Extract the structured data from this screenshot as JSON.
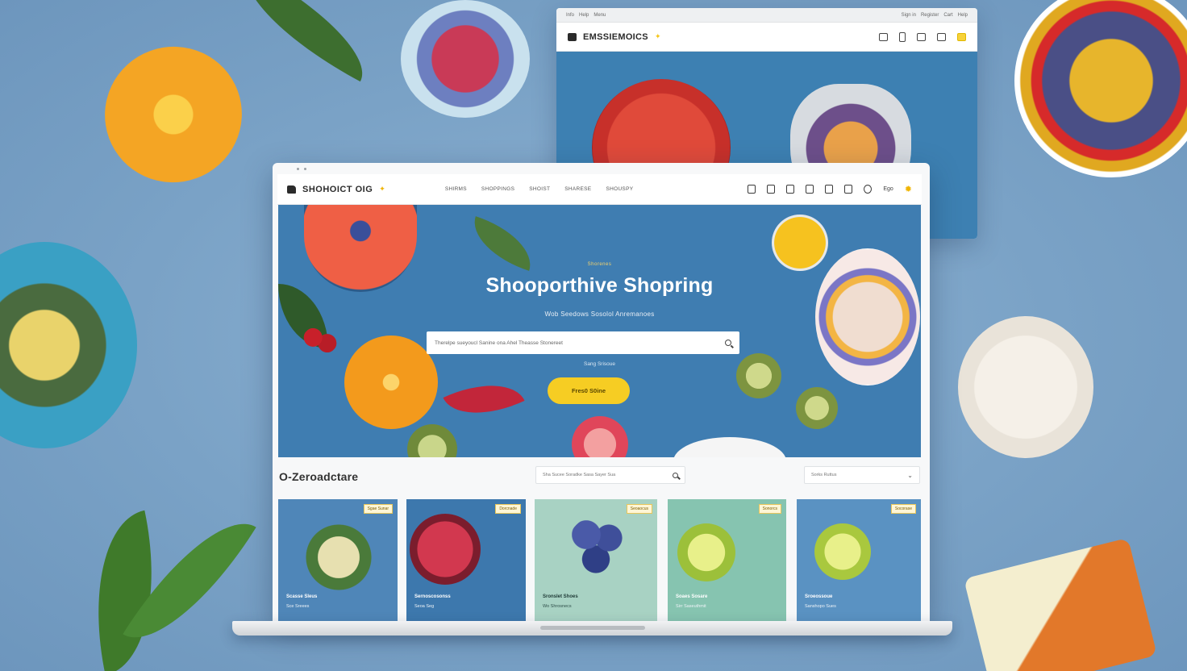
{
  "back_window": {
    "topbar_items": [
      "Info",
      "Help",
      "Menu"
    ],
    "topbar_right": [
      "Sign in",
      "Register",
      "Cart",
      "Help"
    ],
    "logo_text": "EMSSIEMOICS"
  },
  "nav": {
    "logo_text": "SHOHOICT OIG",
    "links": [
      "Shirms",
      "Shoppings",
      "Shoist",
      "Sharese",
      "Shouspy"
    ],
    "account_label": "Ego"
  },
  "hero": {
    "eyebrow": "Shorenes",
    "title": "Shooporthive Shopring",
    "subtitle": "Wob Seedows Sosolol Anremanoes",
    "search_placeholder": "Therelpe sueyoucl Sanine ona Ahel Theasse Stonereet",
    "hint": "Sang Srisoue",
    "cta_label": "Fres0 S0ine"
  },
  "section": {
    "title": "O-Zeroadctare",
    "search_placeholder": "Sha Sucee Soradke Sasa Sayer Sua",
    "sort_label": "Sorks Ruttus"
  },
  "products": [
    {
      "tag": "Sgae Sunar",
      "title": "Scasse Sleus",
      "meta": "Sce Sreees",
      "bg": "#4f86b8"
    },
    {
      "tag": "Dorcnade",
      "title": "Sernoscosonss",
      "meta": "Seoa Seg",
      "bg": "#3d78ad"
    },
    {
      "tag": "Seoaocus",
      "title": "Sronslet Shoes",
      "meta": "Wo Shrosnecs",
      "bg": "#a8d2c3"
    },
    {
      "tag": "Sonorcs",
      "title": "Soaes Sosare",
      "meta": "Sirr Saseuthmit",
      "bg": "#86c4b0"
    },
    {
      "tag": "Socorase",
      "title": "Sroeossoue",
      "meta": "Sanshopo Sues",
      "bg": "#5a92c2"
    }
  ],
  "colors": {
    "background": "#7fa6c8",
    "hero": "#3f7db1",
    "cta": "#f6cd23",
    "accent": "#f0b400"
  }
}
